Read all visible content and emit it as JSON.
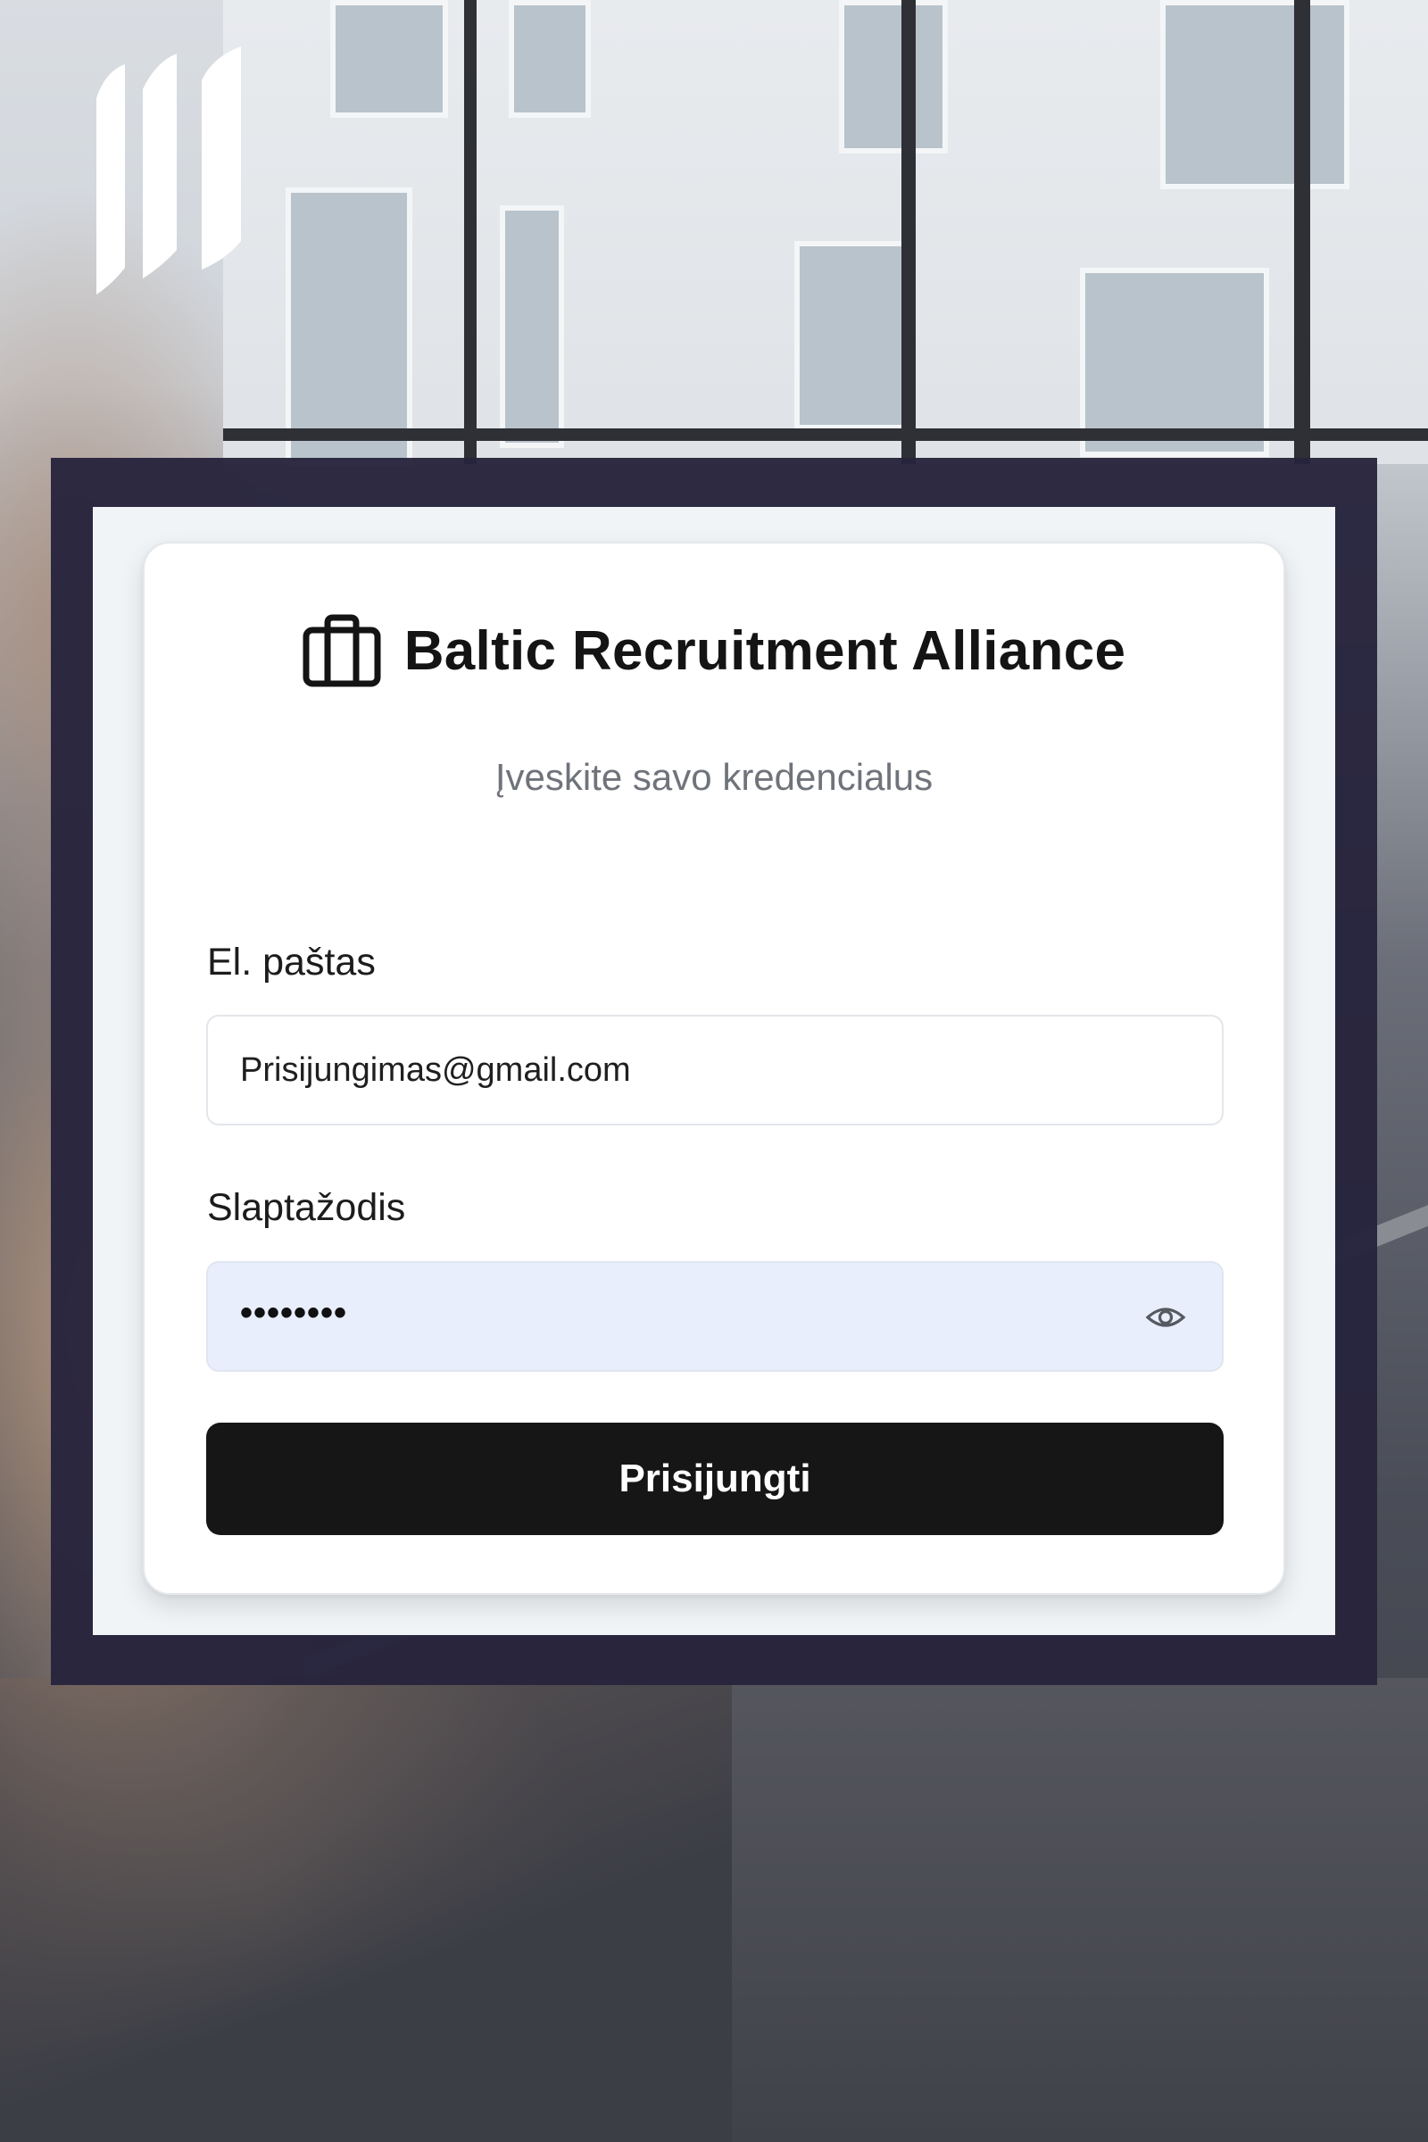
{
  "brand": {
    "icon": "briefcase-icon",
    "title": "Baltic Recruitment Alliance"
  },
  "subtitle": "Įveskite savo kredencialus",
  "form": {
    "email_label": "El. paštas",
    "email_value": "Prisijungimas@gmail.com",
    "password_label": "Slaptažodis",
    "password_masked": "••••••••",
    "password_toggle_icon": "eye-icon",
    "submit_label": "Prisijungti"
  },
  "logo": {
    "icon": "three-stripes-logo"
  },
  "colors": {
    "frame": "#26233c",
    "button": "#161616",
    "password_field_fill": "#e8eefc",
    "subtitle_text": "#6f737a"
  }
}
